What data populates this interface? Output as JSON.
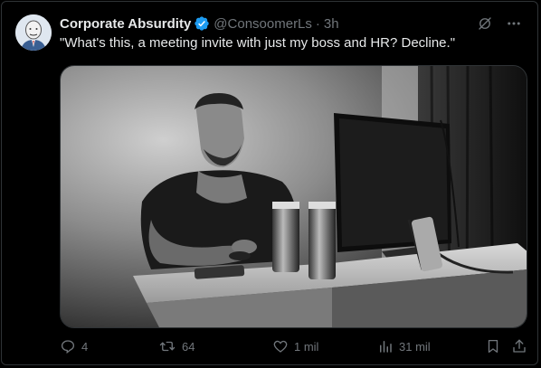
{
  "tweet": {
    "author_name": "Corporate Absurdity",
    "author_handle": "@ConsoomerLs",
    "separator": "·",
    "time": "3h",
    "text": "\"What's this, a meeting invite with just my boss and HR? Decline.\"",
    "verified_color": "#1d9bf0"
  },
  "actions": {
    "replies": "4",
    "reposts": "64",
    "likes": "1 mil",
    "views": "31 mil"
  },
  "icons": {
    "top": [
      "grok-icon",
      "more-icon"
    ],
    "bottom": [
      "reply-icon",
      "repost-icon",
      "like-icon",
      "views-icon",
      "bookmark-icon",
      "share-icon"
    ]
  },
  "colors": {
    "background": "#000000",
    "text": "#e7e9ea",
    "muted": "#71767b",
    "border": "#2f3336"
  }
}
